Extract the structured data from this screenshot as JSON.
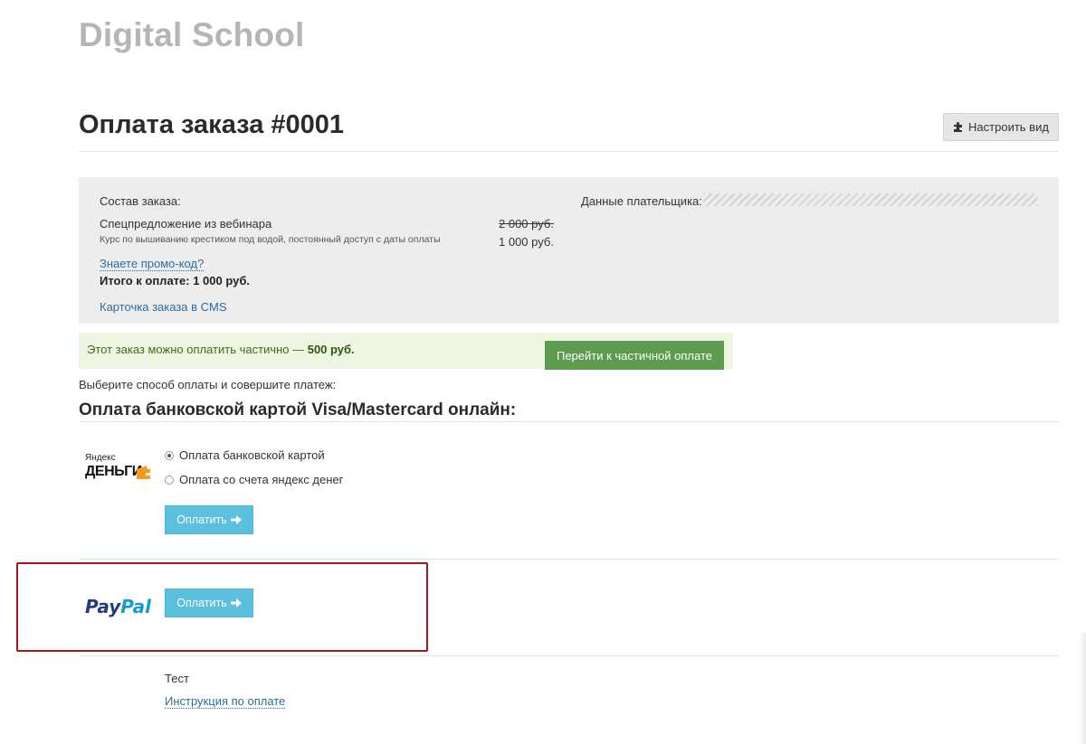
{
  "site": {
    "logo": "Digital School"
  },
  "page": {
    "title": "Оплата заказа #0001",
    "customize_label": "Настроить вид"
  },
  "order": {
    "composition_label": "Состав заказа:",
    "item_name": "Спецпредложение из вебинара",
    "item_description": "Курс по вышиванию крестиком под водой, постоянный доступ с даты оплаты",
    "old_price": "2 000 руб.",
    "new_price": "1 000 руб.",
    "promo_link": "Знаете промо-код?",
    "total": "Итого к оплате: 1 000 руб.",
    "cms_link": "Карточка заказа в CMS",
    "payer_label": "Данные плательщика:"
  },
  "partial": {
    "text": "Этот заказ можно оплатить частично —",
    "amount": "500 руб.",
    "button": "Перейти к частичной оплате"
  },
  "payment": {
    "choose_text": "Выберите способ оплаты и совершите платеж:",
    "section_title": "Оплата банковской картой Visa/Mastercard онлайн:",
    "yandex": {
      "logo_small": "Яндекс",
      "logo_big": "ДЕНЬГИ",
      "options": [
        {
          "label": "Оплата банковской картой",
          "checked": true
        },
        {
          "label": "Оплата со счета яндекс денег",
          "checked": false
        }
      ],
      "pay_button": "Оплатить"
    },
    "paypal": {
      "logo_a": "Pay",
      "logo_b": "Pal",
      "pay_button": "Оплатить"
    },
    "test": {
      "label": "Тест",
      "instruction_link": "Инструкция по оплате"
    }
  },
  "colors": {
    "pay_button": "#5bc0de",
    "partial_button": "#5d9b4f",
    "highlight_border": "#a4161a",
    "link": "#2c6e9e"
  }
}
